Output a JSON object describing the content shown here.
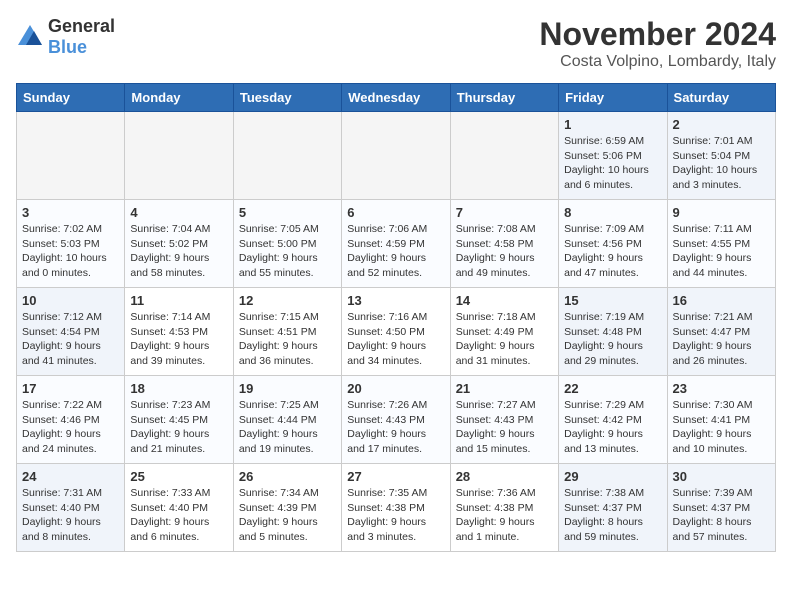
{
  "header": {
    "logo_general": "General",
    "logo_blue": "Blue",
    "month_title": "November 2024",
    "location": "Costa Volpino, Lombardy, Italy"
  },
  "weekdays": [
    "Sunday",
    "Monday",
    "Tuesday",
    "Wednesday",
    "Thursday",
    "Friday",
    "Saturday"
  ],
  "weeks": [
    [
      {
        "day": "",
        "info": "",
        "empty": true
      },
      {
        "day": "",
        "info": "",
        "empty": true
      },
      {
        "day": "",
        "info": "",
        "empty": true
      },
      {
        "day": "",
        "info": "",
        "empty": true
      },
      {
        "day": "",
        "info": "",
        "empty": true
      },
      {
        "day": "1",
        "info": "Sunrise: 6:59 AM\nSunset: 5:06 PM\nDaylight: 10 hours\nand 6 minutes.",
        "weekend": true
      },
      {
        "day": "2",
        "info": "Sunrise: 7:01 AM\nSunset: 5:04 PM\nDaylight: 10 hours\nand 3 minutes.",
        "weekend": true
      }
    ],
    [
      {
        "day": "3",
        "info": "Sunrise: 7:02 AM\nSunset: 5:03 PM\nDaylight: 10 hours\nand 0 minutes.",
        "weekend": true
      },
      {
        "day": "4",
        "info": "Sunrise: 7:04 AM\nSunset: 5:02 PM\nDaylight: 9 hours\nand 58 minutes."
      },
      {
        "day": "5",
        "info": "Sunrise: 7:05 AM\nSunset: 5:00 PM\nDaylight: 9 hours\nand 55 minutes."
      },
      {
        "day": "6",
        "info": "Sunrise: 7:06 AM\nSunset: 4:59 PM\nDaylight: 9 hours\nand 52 minutes."
      },
      {
        "day": "7",
        "info": "Sunrise: 7:08 AM\nSunset: 4:58 PM\nDaylight: 9 hours\nand 49 minutes."
      },
      {
        "day": "8",
        "info": "Sunrise: 7:09 AM\nSunset: 4:56 PM\nDaylight: 9 hours\nand 47 minutes.",
        "weekend": true
      },
      {
        "day": "9",
        "info": "Sunrise: 7:11 AM\nSunset: 4:55 PM\nDaylight: 9 hours\nand 44 minutes.",
        "weekend": true
      }
    ],
    [
      {
        "day": "10",
        "info": "Sunrise: 7:12 AM\nSunset: 4:54 PM\nDaylight: 9 hours\nand 41 minutes.",
        "weekend": true
      },
      {
        "day": "11",
        "info": "Sunrise: 7:14 AM\nSunset: 4:53 PM\nDaylight: 9 hours\nand 39 minutes."
      },
      {
        "day": "12",
        "info": "Sunrise: 7:15 AM\nSunset: 4:51 PM\nDaylight: 9 hours\nand 36 minutes."
      },
      {
        "day": "13",
        "info": "Sunrise: 7:16 AM\nSunset: 4:50 PM\nDaylight: 9 hours\nand 34 minutes."
      },
      {
        "day": "14",
        "info": "Sunrise: 7:18 AM\nSunset: 4:49 PM\nDaylight: 9 hours\nand 31 minutes."
      },
      {
        "day": "15",
        "info": "Sunrise: 7:19 AM\nSunset: 4:48 PM\nDaylight: 9 hours\nand 29 minutes.",
        "weekend": true
      },
      {
        "day": "16",
        "info": "Sunrise: 7:21 AM\nSunset: 4:47 PM\nDaylight: 9 hours\nand 26 minutes.",
        "weekend": true
      }
    ],
    [
      {
        "day": "17",
        "info": "Sunrise: 7:22 AM\nSunset: 4:46 PM\nDaylight: 9 hours\nand 24 minutes.",
        "weekend": true
      },
      {
        "day": "18",
        "info": "Sunrise: 7:23 AM\nSunset: 4:45 PM\nDaylight: 9 hours\nand 21 minutes."
      },
      {
        "day": "19",
        "info": "Sunrise: 7:25 AM\nSunset: 4:44 PM\nDaylight: 9 hours\nand 19 minutes."
      },
      {
        "day": "20",
        "info": "Sunrise: 7:26 AM\nSunset: 4:43 PM\nDaylight: 9 hours\nand 17 minutes."
      },
      {
        "day": "21",
        "info": "Sunrise: 7:27 AM\nSunset: 4:43 PM\nDaylight: 9 hours\nand 15 minutes."
      },
      {
        "day": "22",
        "info": "Sunrise: 7:29 AM\nSunset: 4:42 PM\nDaylight: 9 hours\nand 13 minutes.",
        "weekend": true
      },
      {
        "day": "23",
        "info": "Sunrise: 7:30 AM\nSunset: 4:41 PM\nDaylight: 9 hours\nand 10 minutes.",
        "weekend": true
      }
    ],
    [
      {
        "day": "24",
        "info": "Sunrise: 7:31 AM\nSunset: 4:40 PM\nDaylight: 9 hours\nand 8 minutes.",
        "weekend": true
      },
      {
        "day": "25",
        "info": "Sunrise: 7:33 AM\nSunset: 4:40 PM\nDaylight: 9 hours\nand 6 minutes."
      },
      {
        "day": "26",
        "info": "Sunrise: 7:34 AM\nSunset: 4:39 PM\nDaylight: 9 hours\nand 5 minutes."
      },
      {
        "day": "27",
        "info": "Sunrise: 7:35 AM\nSunset: 4:38 PM\nDaylight: 9 hours\nand 3 minutes."
      },
      {
        "day": "28",
        "info": "Sunrise: 7:36 AM\nSunset: 4:38 PM\nDaylight: 9 hours\nand 1 minute."
      },
      {
        "day": "29",
        "info": "Sunrise: 7:38 AM\nSunset: 4:37 PM\nDaylight: 8 hours\nand 59 minutes.",
        "weekend": true
      },
      {
        "day": "30",
        "info": "Sunrise: 7:39 AM\nSunset: 4:37 PM\nDaylight: 8 hours\nand 57 minutes.",
        "weekend": true
      }
    ]
  ]
}
